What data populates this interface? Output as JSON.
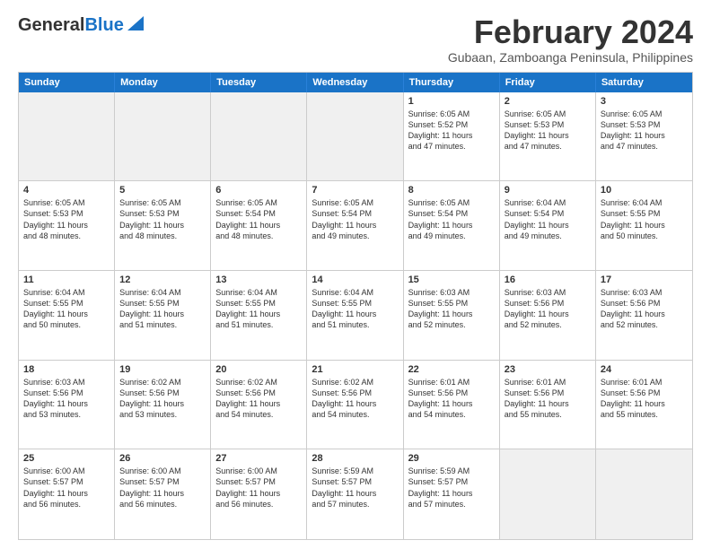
{
  "logo": {
    "line1": "General",
    "line2": "Blue"
  },
  "title": "February 2024",
  "subtitle": "Gubaan, Zamboanga Peninsula, Philippines",
  "header_days": [
    "Sunday",
    "Monday",
    "Tuesday",
    "Wednesday",
    "Thursday",
    "Friday",
    "Saturday"
  ],
  "weeks": [
    [
      {
        "day": "",
        "text": "",
        "shaded": true
      },
      {
        "day": "",
        "text": "",
        "shaded": true
      },
      {
        "day": "",
        "text": "",
        "shaded": true
      },
      {
        "day": "",
        "text": "",
        "shaded": true
      },
      {
        "day": "1",
        "text": "Sunrise: 6:05 AM\nSunset: 5:52 PM\nDaylight: 11 hours\nand 47 minutes.",
        "shaded": false
      },
      {
        "day": "2",
        "text": "Sunrise: 6:05 AM\nSunset: 5:53 PM\nDaylight: 11 hours\nand 47 minutes.",
        "shaded": false
      },
      {
        "day": "3",
        "text": "Sunrise: 6:05 AM\nSunset: 5:53 PM\nDaylight: 11 hours\nand 47 minutes.",
        "shaded": false
      }
    ],
    [
      {
        "day": "4",
        "text": "Sunrise: 6:05 AM\nSunset: 5:53 PM\nDaylight: 11 hours\nand 48 minutes.",
        "shaded": false
      },
      {
        "day": "5",
        "text": "Sunrise: 6:05 AM\nSunset: 5:53 PM\nDaylight: 11 hours\nand 48 minutes.",
        "shaded": false
      },
      {
        "day": "6",
        "text": "Sunrise: 6:05 AM\nSunset: 5:54 PM\nDaylight: 11 hours\nand 48 minutes.",
        "shaded": false
      },
      {
        "day": "7",
        "text": "Sunrise: 6:05 AM\nSunset: 5:54 PM\nDaylight: 11 hours\nand 49 minutes.",
        "shaded": false
      },
      {
        "day": "8",
        "text": "Sunrise: 6:05 AM\nSunset: 5:54 PM\nDaylight: 11 hours\nand 49 minutes.",
        "shaded": false
      },
      {
        "day": "9",
        "text": "Sunrise: 6:04 AM\nSunset: 5:54 PM\nDaylight: 11 hours\nand 49 minutes.",
        "shaded": false
      },
      {
        "day": "10",
        "text": "Sunrise: 6:04 AM\nSunset: 5:55 PM\nDaylight: 11 hours\nand 50 minutes.",
        "shaded": false
      }
    ],
    [
      {
        "day": "11",
        "text": "Sunrise: 6:04 AM\nSunset: 5:55 PM\nDaylight: 11 hours\nand 50 minutes.",
        "shaded": false
      },
      {
        "day": "12",
        "text": "Sunrise: 6:04 AM\nSunset: 5:55 PM\nDaylight: 11 hours\nand 51 minutes.",
        "shaded": false
      },
      {
        "day": "13",
        "text": "Sunrise: 6:04 AM\nSunset: 5:55 PM\nDaylight: 11 hours\nand 51 minutes.",
        "shaded": false
      },
      {
        "day": "14",
        "text": "Sunrise: 6:04 AM\nSunset: 5:55 PM\nDaylight: 11 hours\nand 51 minutes.",
        "shaded": false
      },
      {
        "day": "15",
        "text": "Sunrise: 6:03 AM\nSunset: 5:55 PM\nDaylight: 11 hours\nand 52 minutes.",
        "shaded": false
      },
      {
        "day": "16",
        "text": "Sunrise: 6:03 AM\nSunset: 5:56 PM\nDaylight: 11 hours\nand 52 minutes.",
        "shaded": false
      },
      {
        "day": "17",
        "text": "Sunrise: 6:03 AM\nSunset: 5:56 PM\nDaylight: 11 hours\nand 52 minutes.",
        "shaded": false
      }
    ],
    [
      {
        "day": "18",
        "text": "Sunrise: 6:03 AM\nSunset: 5:56 PM\nDaylight: 11 hours\nand 53 minutes.",
        "shaded": false
      },
      {
        "day": "19",
        "text": "Sunrise: 6:02 AM\nSunset: 5:56 PM\nDaylight: 11 hours\nand 53 minutes.",
        "shaded": false
      },
      {
        "day": "20",
        "text": "Sunrise: 6:02 AM\nSunset: 5:56 PM\nDaylight: 11 hours\nand 54 minutes.",
        "shaded": false
      },
      {
        "day": "21",
        "text": "Sunrise: 6:02 AM\nSunset: 5:56 PM\nDaylight: 11 hours\nand 54 minutes.",
        "shaded": false
      },
      {
        "day": "22",
        "text": "Sunrise: 6:01 AM\nSunset: 5:56 PM\nDaylight: 11 hours\nand 54 minutes.",
        "shaded": false
      },
      {
        "day": "23",
        "text": "Sunrise: 6:01 AM\nSunset: 5:56 PM\nDaylight: 11 hours\nand 55 minutes.",
        "shaded": false
      },
      {
        "day": "24",
        "text": "Sunrise: 6:01 AM\nSunset: 5:56 PM\nDaylight: 11 hours\nand 55 minutes.",
        "shaded": false
      }
    ],
    [
      {
        "day": "25",
        "text": "Sunrise: 6:00 AM\nSunset: 5:57 PM\nDaylight: 11 hours\nand 56 minutes.",
        "shaded": false
      },
      {
        "day": "26",
        "text": "Sunrise: 6:00 AM\nSunset: 5:57 PM\nDaylight: 11 hours\nand 56 minutes.",
        "shaded": false
      },
      {
        "day": "27",
        "text": "Sunrise: 6:00 AM\nSunset: 5:57 PM\nDaylight: 11 hours\nand 56 minutes.",
        "shaded": false
      },
      {
        "day": "28",
        "text": "Sunrise: 5:59 AM\nSunset: 5:57 PM\nDaylight: 11 hours\nand 57 minutes.",
        "shaded": false
      },
      {
        "day": "29",
        "text": "Sunrise: 5:59 AM\nSunset: 5:57 PM\nDaylight: 11 hours\nand 57 minutes.",
        "shaded": false
      },
      {
        "day": "",
        "text": "",
        "shaded": true
      },
      {
        "day": "",
        "text": "",
        "shaded": true
      }
    ]
  ]
}
